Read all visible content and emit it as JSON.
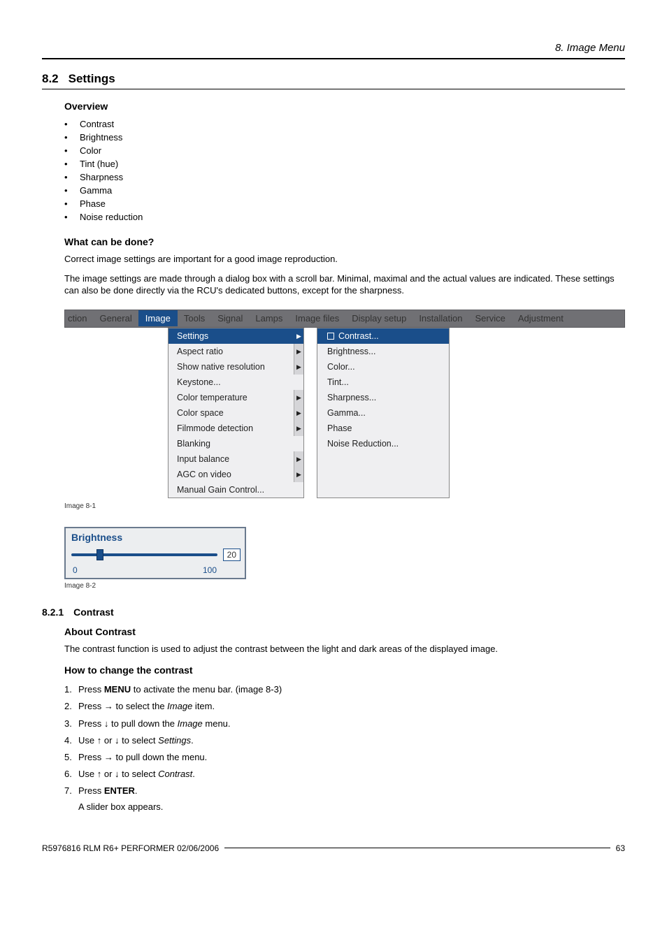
{
  "header": {
    "chapter": "8. Image Menu"
  },
  "section": {
    "num": "8.2",
    "title": "Settings"
  },
  "overview": {
    "heading": "Overview",
    "items": [
      "Contrast",
      "Brightness",
      "Color",
      "Tint (hue)",
      "Sharpness",
      "Gamma",
      "Phase",
      "Noise reduction"
    ]
  },
  "whatcan": {
    "heading": "What can be done?",
    "p1": "Correct image settings are important for a good image reproduction.",
    "p2": "The image settings are made through a dialog box with a scroll bar. Minimal, maximal and the actual values are indicated. These settings can also be done directly via the RCU's dedicated buttons, except for the sharpness."
  },
  "menubar": {
    "items": [
      "ction",
      "General",
      "Image",
      "Tools",
      "Signal",
      "Lamps",
      "Image files",
      "Display setup",
      "Installation",
      "Service",
      "Adjustment"
    ],
    "active_index": 2
  },
  "dropdown1": {
    "items": [
      {
        "label": "Settings",
        "arrow": true,
        "highlight": true
      },
      {
        "label": "Aspect ratio",
        "arrow": true
      },
      {
        "label": "Show native resolution",
        "arrow": true
      },
      {
        "label": "Keystone...",
        "arrow": false
      },
      {
        "label": "Color temperature",
        "arrow": true
      },
      {
        "label": "Color space",
        "arrow": true
      },
      {
        "label": "Filmmode detection",
        "arrow": true
      },
      {
        "label": "Blanking",
        "arrow": false
      },
      {
        "label": "Input balance",
        "arrow": true
      },
      {
        "label": "AGC on video",
        "arrow": true
      },
      {
        "label": "Manual Gain Control...",
        "arrow": false
      }
    ]
  },
  "dropdown2": {
    "items": [
      {
        "label": "Contrast...",
        "highlight": true,
        "check": true
      },
      {
        "label": "Brightness..."
      },
      {
        "label": "Color..."
      },
      {
        "label": "Tint..."
      },
      {
        "label": "Sharpness..."
      },
      {
        "label": "Gamma..."
      },
      {
        "label": "Phase"
      },
      {
        "label": "Noise Reduction..."
      }
    ]
  },
  "fig1": {
    "caption": "Image 8-1"
  },
  "fig2": {
    "title": "Brightness",
    "min": "0",
    "max": "100",
    "value": "20",
    "caption": "Image 8-2"
  },
  "subsection": {
    "num": "8.2.1",
    "title": "Contrast",
    "about_heading": "About Contrast",
    "about_text": "The contrast function is used to adjust the contrast between the light and dark areas of the displayed image.",
    "howto_heading": "How to change the contrast",
    "steps": {
      "s1a": "Press ",
      "s1b": "MENU",
      "s1c": " to activate the menu bar. (image 8-3)",
      "s2a": "Press → to select the ",
      "s2b": "Image",
      "s2c": " item.",
      "s3a": "Press ↓ to pull down the ",
      "s3b": "Image",
      "s3c": " menu.",
      "s4a": "Use ↑ or ↓ to select ",
      "s4b": "Settings",
      "s4c": ".",
      "s5": "Press → to pull down the menu.",
      "s6a": "Use ↑ or ↓ to select ",
      "s6b": "Contrast",
      "s6c": ".",
      "s7a": "Press ",
      "s7b": "ENTER",
      "s7c": ".",
      "s7sub": "A slider box appears."
    }
  },
  "footer": {
    "left": "R5976816 RLM R6+ PERFORMER 02/06/2006",
    "right": "63"
  }
}
